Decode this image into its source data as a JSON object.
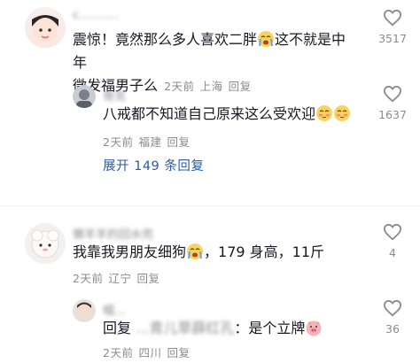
{
  "comments": [
    {
      "name": "c...........",
      "text_a": "震惊！竟然那么多人喜欢二胖",
      "text_b": "这不就是中年",
      "text_c": "微发福男子么",
      "time": "2天前",
      "location": "上海",
      "reply_label": "回复",
      "likes": "3517",
      "emoji_icon": "crying-emoji",
      "reply": {
        "name": "哥克",
        "text": "八戒都不知道自己原来这么受欢迎",
        "time": "2天前",
        "location": "福建",
        "reply_label": "回复",
        "likes": "1637",
        "emoji_icon": "blushing-emoji"
      },
      "expand_label": "展开 149 条回复"
    },
    {
      "name": "懒羊羊的回水兜",
      "text": "我靠我男朋友细狗",
      "text_b": "，179 身高，11斤",
      "time": "2天前",
      "location": "辽宁",
      "reply_label": "回复",
      "likes": "4",
      "emoji_icon": "crying-emoji",
      "reply": {
        "name": "帽...",
        "prefix": "回复",
        "hidden": "...青儿草薛红孔",
        "text": "：是个立牌",
        "time": "2天前",
        "location": "四川",
        "reply_label": "回复",
        "likes": "36",
        "emoji_icon": "pig-face-emoji"
      }
    }
  ],
  "colors": {
    "text": "#161823",
    "meta": "#8a8b91",
    "link": "#2b5aa8"
  }
}
